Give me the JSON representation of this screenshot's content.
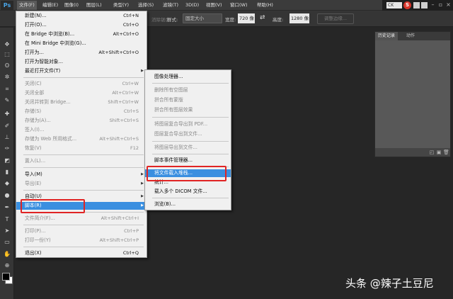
{
  "app": {
    "logo": "Ps"
  },
  "menubar": {
    "items": [
      {
        "label": "文件(F)",
        "active": true
      },
      {
        "label": "编辑(E)"
      },
      {
        "label": "图像(I)"
      },
      {
        "label": "图层(L)"
      },
      {
        "label": "类型(Y)"
      },
      {
        "label": "选择(S)"
      },
      {
        "label": "滤镜(T)"
      },
      {
        "label": "3D(D)"
      },
      {
        "label": "视图(V)"
      },
      {
        "label": "窗口(W)"
      },
      {
        "label": "帮助(H)"
      }
    ],
    "tray_text": "CK"
  },
  "options_bar": {
    "feather_suffix": "消除锯齿",
    "style_label": "样式:",
    "style_value": "固定大小",
    "width_label": "宽度:",
    "width_value": "720 像",
    "height_label": "高度:",
    "height_value": "1280 像",
    "refine_edge": "调整边缘..."
  },
  "history_panel": {
    "tabs": [
      "历史记录",
      "动作"
    ]
  },
  "file_menu": {
    "items": [
      {
        "label": "新建(N)...",
        "shortcut": "Ctrl+N"
      },
      {
        "label": "打开(O)...",
        "shortcut": "Ctrl+O"
      },
      {
        "label": "在 Bridge 中浏览(B)...",
        "shortcut": "Alt+Ctrl+O"
      },
      {
        "label": "在 Mini Bridge 中浏览(G)..."
      },
      {
        "label": "打开为...",
        "shortcut": "Alt+Shift+Ctrl+O"
      },
      {
        "label": "打开为智能对象..."
      },
      {
        "label": "最近打开文件(T)",
        "submenu": true
      },
      {
        "label": "关闭(C)",
        "shortcut": "Ctrl+W",
        "disabled": true
      },
      {
        "label": "关闭全部",
        "shortcut": "Alt+Ctrl+W",
        "disabled": true
      },
      {
        "label": "关闭并转到 Bridge...",
        "shortcut": "Shift+Ctrl+W",
        "disabled": true
      },
      {
        "label": "存储(S)",
        "shortcut": "Ctrl+S",
        "disabled": true
      },
      {
        "label": "存储为(A)...",
        "shortcut": "Shift+Ctrl+S",
        "disabled": true
      },
      {
        "label": "签入(I)...",
        "disabled": true
      },
      {
        "label": "存储为 Web 所用格式...",
        "shortcut": "Alt+Shift+Ctrl+S",
        "disabled": true
      },
      {
        "label": "恢复(V)",
        "shortcut": "F12",
        "disabled": true
      },
      {
        "label": "置入(L)...",
        "disabled": true
      },
      {
        "label": "导入(M)",
        "submenu": true
      },
      {
        "label": "导出(E)",
        "submenu": true,
        "disabled": true
      },
      {
        "label": "自动(U)",
        "submenu": true
      },
      {
        "label": "脚本(R)",
        "submenu": true,
        "highlighted": true
      },
      {
        "label": "文件简介(F)...",
        "shortcut": "Alt+Shift+Ctrl+I",
        "disabled": true
      },
      {
        "label": "打印(P)...",
        "shortcut": "Ctrl+P",
        "disabled": true
      },
      {
        "label": "打印一份(Y)",
        "shortcut": "Alt+Shift+Ctrl+P",
        "disabled": true
      },
      {
        "label": "退出(X)",
        "shortcut": "Ctrl+Q"
      }
    ]
  },
  "scripts_submenu": {
    "items": [
      {
        "label": "图像处理器..."
      },
      {
        "label": "删除所有空图层",
        "disabled": true
      },
      {
        "label": "拼合所有蒙版",
        "disabled": true
      },
      {
        "label": "拼合所有图层效果",
        "disabled": true
      },
      {
        "label": "将图层复合导出到 PDF...",
        "disabled": true
      },
      {
        "label": "图层复合导出到文件...",
        "disabled": true
      },
      {
        "label": "将图层导出到文件...",
        "disabled": true
      },
      {
        "label": "脚本事件管理器..."
      },
      {
        "label": "将文件载入堆栈...",
        "highlighted": true
      },
      {
        "label": "统计..."
      },
      {
        "label": "载入多个 DICOM 文件..."
      },
      {
        "label": "浏览(B)..."
      }
    ]
  },
  "watermark": "头条 @辣子土豆尼"
}
